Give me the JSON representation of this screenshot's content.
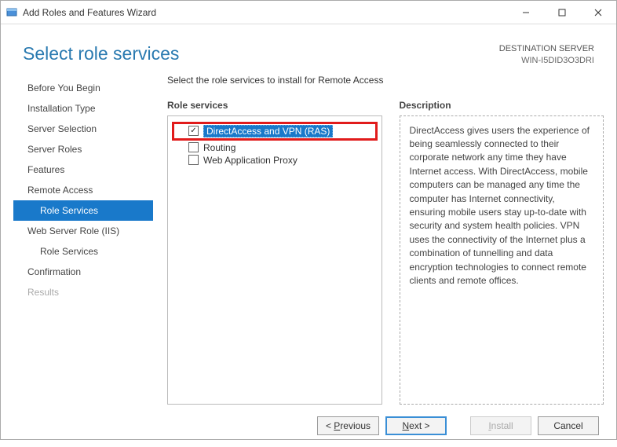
{
  "window": {
    "title": "Add Roles and Features Wizard"
  },
  "header": {
    "page_title": "Select role services",
    "destination_label": "DESTINATION SERVER",
    "destination_server": "WIN-I5DID3O3DRI"
  },
  "nav": {
    "items": [
      {
        "label": "Before You Begin",
        "selected": false,
        "sub": false,
        "disabled": false
      },
      {
        "label": "Installation Type",
        "selected": false,
        "sub": false,
        "disabled": false
      },
      {
        "label": "Server Selection",
        "selected": false,
        "sub": false,
        "disabled": false
      },
      {
        "label": "Server Roles",
        "selected": false,
        "sub": false,
        "disabled": false
      },
      {
        "label": "Features",
        "selected": false,
        "sub": false,
        "disabled": false
      },
      {
        "label": "Remote Access",
        "selected": false,
        "sub": false,
        "disabled": false
      },
      {
        "label": "Role Services",
        "selected": true,
        "sub": true,
        "disabled": false
      },
      {
        "label": "Web Server Role (IIS)",
        "selected": false,
        "sub": false,
        "disabled": false
      },
      {
        "label": "Role Services",
        "selected": false,
        "sub": true,
        "disabled": false
      },
      {
        "label": "Confirmation",
        "selected": false,
        "sub": false,
        "disabled": false
      },
      {
        "label": "Results",
        "selected": false,
        "sub": false,
        "disabled": true
      }
    ]
  },
  "main": {
    "instruction": "Select the role services to install for Remote Access",
    "roles_title": "Role services",
    "roles": [
      {
        "label": "DirectAccess and VPN (RAS)",
        "checked": true,
        "highlighted": true
      },
      {
        "label": "Routing",
        "checked": false,
        "highlighted": false
      },
      {
        "label": "Web Application Proxy",
        "checked": false,
        "highlighted": false
      }
    ],
    "description_title": "Description",
    "description_text": "DirectAccess gives users the experience of being seamlessly connected to their corporate network any time they have Internet access. With DirectAccess, mobile computers can be managed any time the computer has Internet connectivity, ensuring mobile users stay up-to-date with security and system health policies. VPN uses the connectivity of the Internet plus a combination of tunnelling and data encryption technologies to connect remote clients and remote offices."
  },
  "footer": {
    "previous": "< Previous",
    "next": "Next >",
    "install": "Install",
    "cancel": "Cancel"
  }
}
